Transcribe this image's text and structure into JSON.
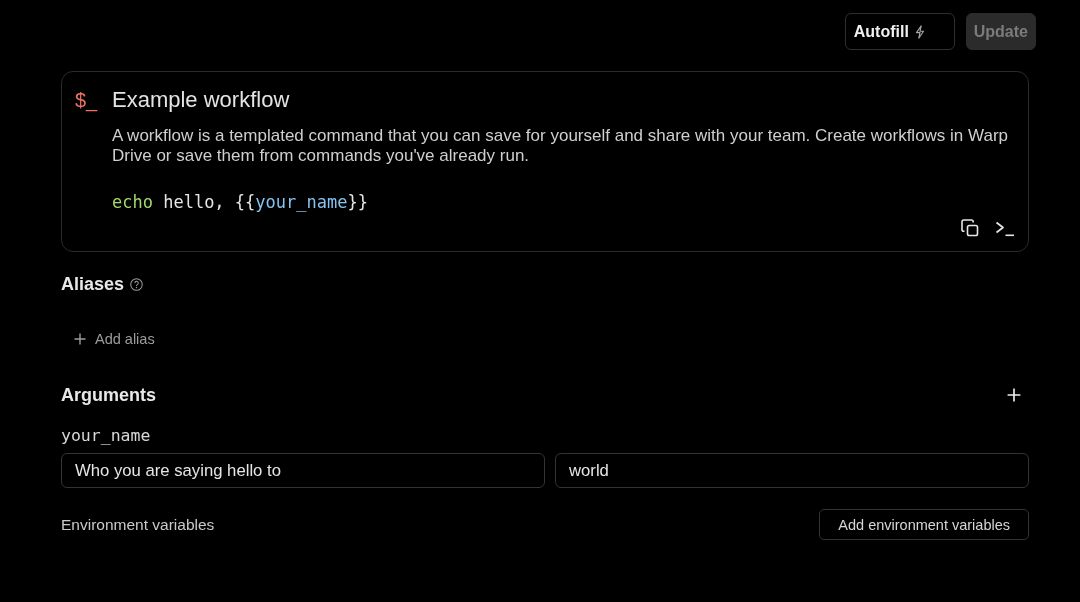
{
  "autofill_button": {
    "label": "Autofill",
    "disabled": false
  },
  "update_button": {
    "label": "Update",
    "disabled": true
  },
  "workflow": {
    "icon": "$_",
    "title": "Example workflow",
    "description": "A workflow is a templated command that you can save for yourself and share with your team. Create workflows in Warp Drive or save them from commands you've already run.",
    "command": [
      {
        "text": "echo",
        "kind": "keyword"
      },
      {
        "text": " hello, {{",
        "kind": "plain"
      },
      {
        "text": "your_name",
        "kind": "argument"
      },
      {
        "text": "}}",
        "kind": "plain"
      }
    ]
  },
  "aliases": {
    "title": "Aliases",
    "add_label": "Add alias"
  },
  "arguments": {
    "title": "Arguments",
    "items": [
      {
        "name": "your_name",
        "fields": [
          {
            "value": "Who you are saying hello to"
          },
          {
            "value": "world"
          }
        ]
      }
    ]
  },
  "environment_variables": {
    "label": "Environment variables",
    "button": "Add environment variables"
  }
}
